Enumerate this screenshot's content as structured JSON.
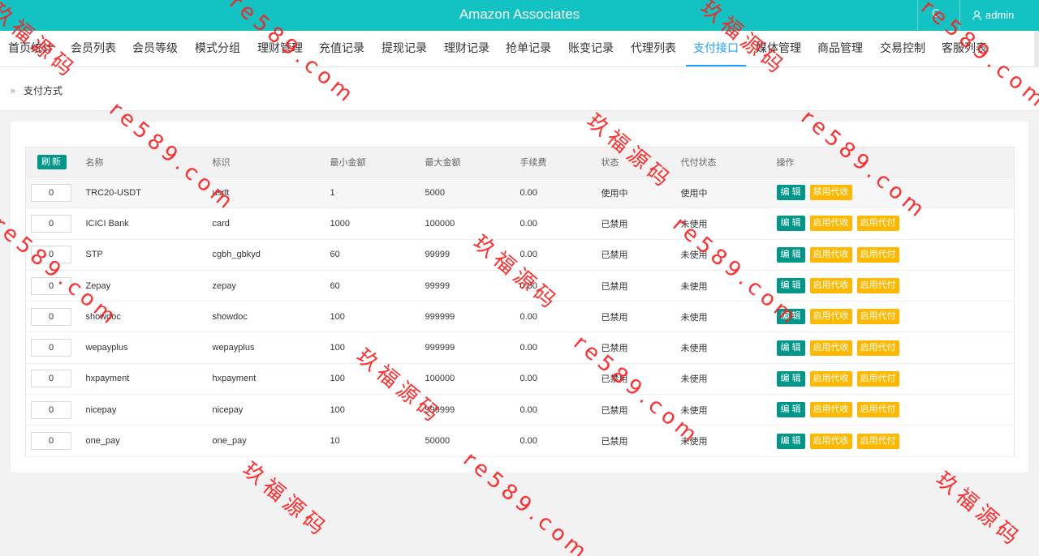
{
  "topbar": {
    "title": "Amazon Associates",
    "left_glyph": "C",
    "username": "admin"
  },
  "nav": {
    "items": [
      {
        "label": "首页统计"
      },
      {
        "label": "会员列表"
      },
      {
        "label": "会员等级"
      },
      {
        "label": "模式分组"
      },
      {
        "label": "理财管理"
      },
      {
        "label": "充值记录"
      },
      {
        "label": "提现记录"
      },
      {
        "label": "理财记录"
      },
      {
        "label": "抢单记录"
      },
      {
        "label": "账变记录"
      },
      {
        "label": "代理列表"
      },
      {
        "label": "支付接口",
        "active": true
      },
      {
        "label": "媒体管理"
      },
      {
        "label": "商品管理"
      },
      {
        "label": "交易控制"
      },
      {
        "label": "客服列表"
      }
    ]
  },
  "breadcrumb": {
    "arrows": "»",
    "label": "支付方式"
  },
  "table": {
    "refresh_label": "刷新",
    "headers": [
      "名称",
      "标识",
      "最小金额",
      "最大金额",
      "手续费",
      "状态",
      "代付状态",
      "操作"
    ],
    "rows": [
      {
        "sort": "0",
        "name": "TRC20-USDT",
        "code": "usdt",
        "min": "1",
        "max": "5000",
        "fee": "0.00",
        "status": "使用中",
        "status_on": true,
        "payout": "使用中",
        "payout_on": true,
        "actions": [
          "编辑",
          "禁用代收"
        ]
      },
      {
        "sort": "0",
        "name": "ICICI Bank",
        "code": "card",
        "min": "1000",
        "max": "100000",
        "fee": "0.00",
        "status": "已禁用",
        "status_on": false,
        "payout": "未使用",
        "payout_on": false,
        "actions": [
          "编辑",
          "启用代收",
          "启用代付"
        ]
      },
      {
        "sort": "0",
        "name": "STP",
        "code": "cgbh_gbkyd",
        "min": "60",
        "max": "99999",
        "fee": "0.00",
        "status": "已禁用",
        "status_on": false,
        "payout": "未使用",
        "payout_on": false,
        "actions": [
          "编辑",
          "启用代收",
          "启用代付"
        ]
      },
      {
        "sort": "0",
        "name": "Zepay",
        "code": "zepay",
        "min": "60",
        "max": "99999",
        "fee": "0.00",
        "status": "已禁用",
        "status_on": false,
        "payout": "未使用",
        "payout_on": false,
        "actions": [
          "编辑",
          "启用代收",
          "启用代付"
        ]
      },
      {
        "sort": "0",
        "name": "showdoc",
        "code": "showdoc",
        "min": "100",
        "max": "999999",
        "fee": "0.00",
        "status": "已禁用",
        "status_on": false,
        "payout": "未使用",
        "payout_on": false,
        "actions": [
          "编辑",
          "启用代收",
          "启用代付"
        ]
      },
      {
        "sort": "0",
        "name": "wepayplus",
        "code": "wepayplus",
        "min": "100",
        "max": "999999",
        "fee": "0.00",
        "status": "已禁用",
        "status_on": false,
        "payout": "未使用",
        "payout_on": false,
        "actions": [
          "编辑",
          "启用代收",
          "启用代付"
        ]
      },
      {
        "sort": "0",
        "name": "hxpayment",
        "code": "hxpayment",
        "min": "100",
        "max": "100000",
        "fee": "0.00",
        "status": "已禁用",
        "status_on": false,
        "payout": "未使用",
        "payout_on": false,
        "actions": [
          "编辑",
          "启用代收",
          "启用代付"
        ]
      },
      {
        "sort": "0",
        "name": "nicepay",
        "code": "nicepay",
        "min": "100",
        "max": "999999",
        "fee": "0.00",
        "status": "已禁用",
        "status_on": false,
        "payout": "未使用",
        "payout_on": false,
        "actions": [
          "编辑",
          "启用代收",
          "启用代付"
        ]
      },
      {
        "sort": "0",
        "name": "one_pay",
        "code": "one_pay",
        "min": "10",
        "max": "50000",
        "fee": "0.00",
        "status": "已禁用",
        "status_on": false,
        "payout": "未使用",
        "payout_on": false,
        "actions": [
          "编辑",
          "启用代收",
          "启用代付"
        ]
      }
    ]
  },
  "watermark": {
    "cn": "玖福源码",
    "url": "re589.com"
  },
  "colors": {
    "topbar": "#13c2c2",
    "active_tab": "#1e9fff",
    "primary_button": "#009688",
    "warn_button": "#ffb800",
    "status_on": "#009688",
    "status_off": "#ff3b30",
    "watermark": "#ff1e1e"
  }
}
